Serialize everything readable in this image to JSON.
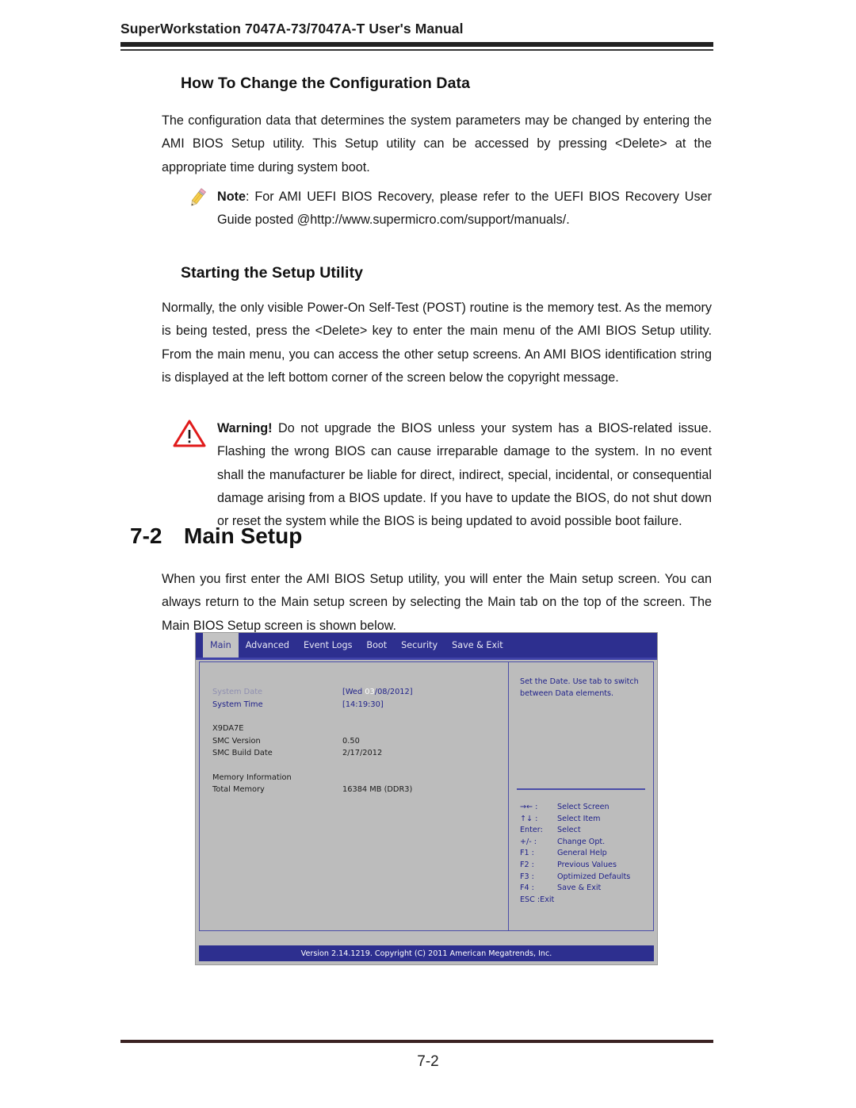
{
  "header": {
    "running_title": "SuperWorkstation 7047A-73/7047A-T User's Manual"
  },
  "sections": {
    "howto": {
      "heading": "How To Change the Configuration Data",
      "paragraph": "The configuration data that determines the system parameters may be changed by entering the AMI BIOS Setup utility. This Setup utility can be accessed by pressing <Delete> at the appropriate time during system boot."
    },
    "note": {
      "icon": "pencil-icon",
      "label": "Note",
      "text": ": For AMI UEFI BIOS Recovery, please refer to the UEFI BIOS Recovery User Guide posted @http://www.supermicro.com/support/manuals/."
    },
    "starting": {
      "heading": "Starting the Setup Utility",
      "paragraph": "Normally, the only visible Power-On Self-Test (POST) routine is the memory test. As the memory is being tested, press the <Delete> key to enter the main menu of the AMI BIOS Setup utility. From the main menu, you can access the other setup screens. An AMI BIOS identification string is displayed at the left bottom corner of the screen below the copyright message."
    },
    "warning": {
      "icon": "warning-triangle-icon",
      "label": "Warning!",
      "text": " Do not upgrade the BIOS unless your system has a BIOS-related issue. Flashing the wrong BIOS can cause irreparable damage to the system. In no event shall the manufacturer be liable for direct, indirect, special, incidental, or consequential damage arising from a BIOS update. If you have to update the BIOS, do not shut down or reset the system while the BIOS is being updated to avoid possible boot failure."
    },
    "main_setup": {
      "number": "7-2",
      "heading": "Main Setup",
      "paragraph": "When you first enter the AMI BIOS Setup utility, you will enter the Main setup screen. You can always return to the Main setup screen by selecting the Main tab on the top of the screen. The Main BIOS Setup screen is shown below."
    }
  },
  "bios": {
    "tabs": [
      {
        "label": "Main",
        "active": true
      },
      {
        "label": "Advanced",
        "active": false
      },
      {
        "label": "Event Logs",
        "active": false
      },
      {
        "label": "Boot",
        "active": false
      },
      {
        "label": "Security",
        "active": false
      },
      {
        "label": "Save & Exit",
        "active": false
      }
    ],
    "fields": [
      {
        "label": "System Date",
        "value_prefix": "[Wed ",
        "value_highlight": "03",
        "value_suffix": "/08/2012]",
        "dim_label": true
      },
      {
        "label": "System Time",
        "value": "[14:19:30]",
        "dim_label": false
      }
    ],
    "info_group_1": [
      {
        "label": "X9DA7E",
        "value": ""
      },
      {
        "label": "SMC Version",
        "value": "0.50"
      },
      {
        "label": "SMC Build Date",
        "value": "2/17/2012"
      }
    ],
    "info_group_2": [
      {
        "label": "Memory Information",
        "value": ""
      },
      {
        "label": "Total Memory",
        "value": "16384 MB (DDR3)"
      }
    ],
    "help_text": "Set the Date.  Use tab to switch between Data elements.",
    "keys": [
      {
        "key": "→← :",
        "desc": "Select Screen"
      },
      {
        "key": "↑↓  :",
        "desc": "Select Item"
      },
      {
        "key": "Enter:",
        "desc": "Select"
      },
      {
        "key": "+/-  :",
        "desc": "Change Opt."
      },
      {
        "key": "F1 :",
        "desc": "General Help"
      },
      {
        "key": "F2 :",
        "desc": "Previous Values"
      },
      {
        "key": "F3 :",
        "desc": "Optimized Defaults"
      },
      {
        "key": "F4 :",
        "desc": "Save & Exit"
      },
      {
        "key": "ESC :Exit",
        "desc": ""
      }
    ],
    "footer": "Version 2.14.1219. Copyright (C) 2011 American Megatrends, Inc."
  },
  "footer": {
    "page_number": "7-2"
  },
  "colors": {
    "bios_blue": "#2d2f8f",
    "bios_gray": "#bcbcbc",
    "warning_red": "#d92121",
    "pencil_yellow": "#f2c23e"
  }
}
